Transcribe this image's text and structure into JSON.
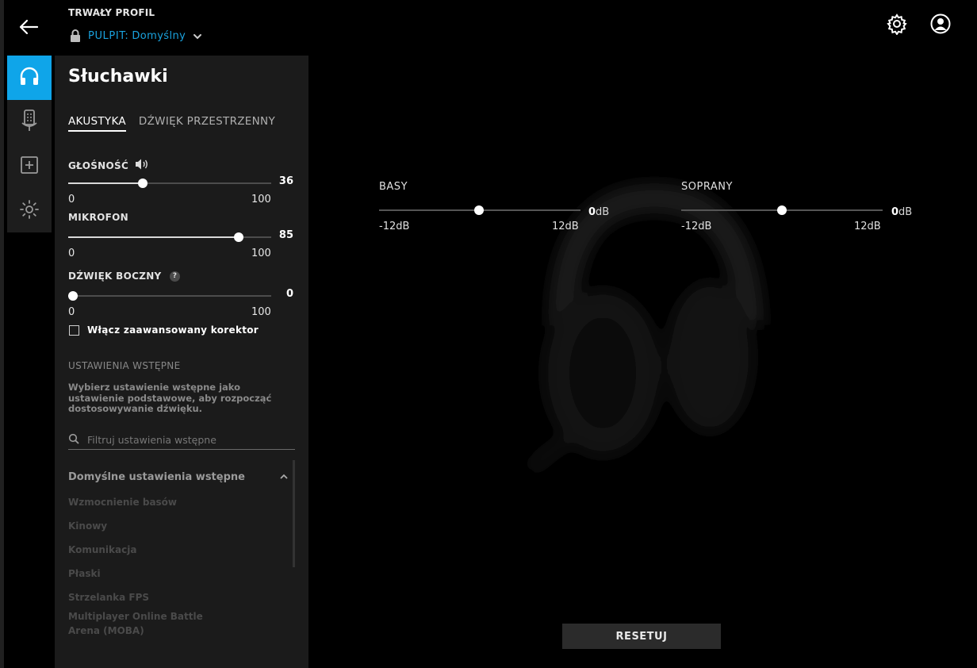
{
  "header": {
    "profile_title": "TRWAŁY PROFIL",
    "profile_name": "PULPIT:",
    "profile_value": "Domyślny"
  },
  "rail": {
    "items": [
      {
        "icon": "headphones-icon",
        "active": true
      },
      {
        "icon": "microphone-icon",
        "active": false
      },
      {
        "icon": "add-icon",
        "active": false
      },
      {
        "icon": "brightness-icon",
        "active": false
      }
    ]
  },
  "panel": {
    "title": "Słuchawki",
    "tabs": [
      {
        "label": "AKUSTYKA",
        "active": true
      },
      {
        "label": "DŹWIĘK PRZESTRZENNY",
        "active": false
      }
    ],
    "volume": {
      "label": "GŁOŚNOŚĆ",
      "value": "36",
      "min": "0",
      "max": "100"
    },
    "microphone": {
      "label": "MIKROFON",
      "value": "85",
      "min": "0",
      "max": "100"
    },
    "sidetone": {
      "label": "DŹWIĘK BOCZNY",
      "help": "?",
      "value": "0",
      "min": "0",
      "max": "100"
    },
    "advanced_eq_label": "Włącz zaawansowany korektor",
    "presets": {
      "heading": "USTAWIENIA WSTĘPNE",
      "description": "Wybierz ustawienie wstępne jako ustawienie podstawowe, aby rozpocząć dostosowywanie dźwięku.",
      "filter_placeholder": "Filtruj ustawienia wstępne",
      "group_title": "Domyślne ustawienia wstępne",
      "items": [
        "Wzmocnienie basów",
        "Kinowy",
        "Komunikacja",
        "Płaski",
        "Strzelanka FPS",
        "Multiplayer Online Battle Arena (MOBA)"
      ]
    }
  },
  "eq": {
    "bass": {
      "label": "BASY",
      "value": "0",
      "unit": "dB",
      "min": "-12dB",
      "max": "12dB"
    },
    "treble": {
      "label": "SOPRANY",
      "value": "0",
      "unit": "dB",
      "min": "-12dB",
      "max": "12dB"
    }
  },
  "reset_label": "RESETUJ",
  "colors": {
    "accent": "#0fa5e9",
    "profile_text": "#1aa3df",
    "panel_bg": "#1b1b1b"
  }
}
